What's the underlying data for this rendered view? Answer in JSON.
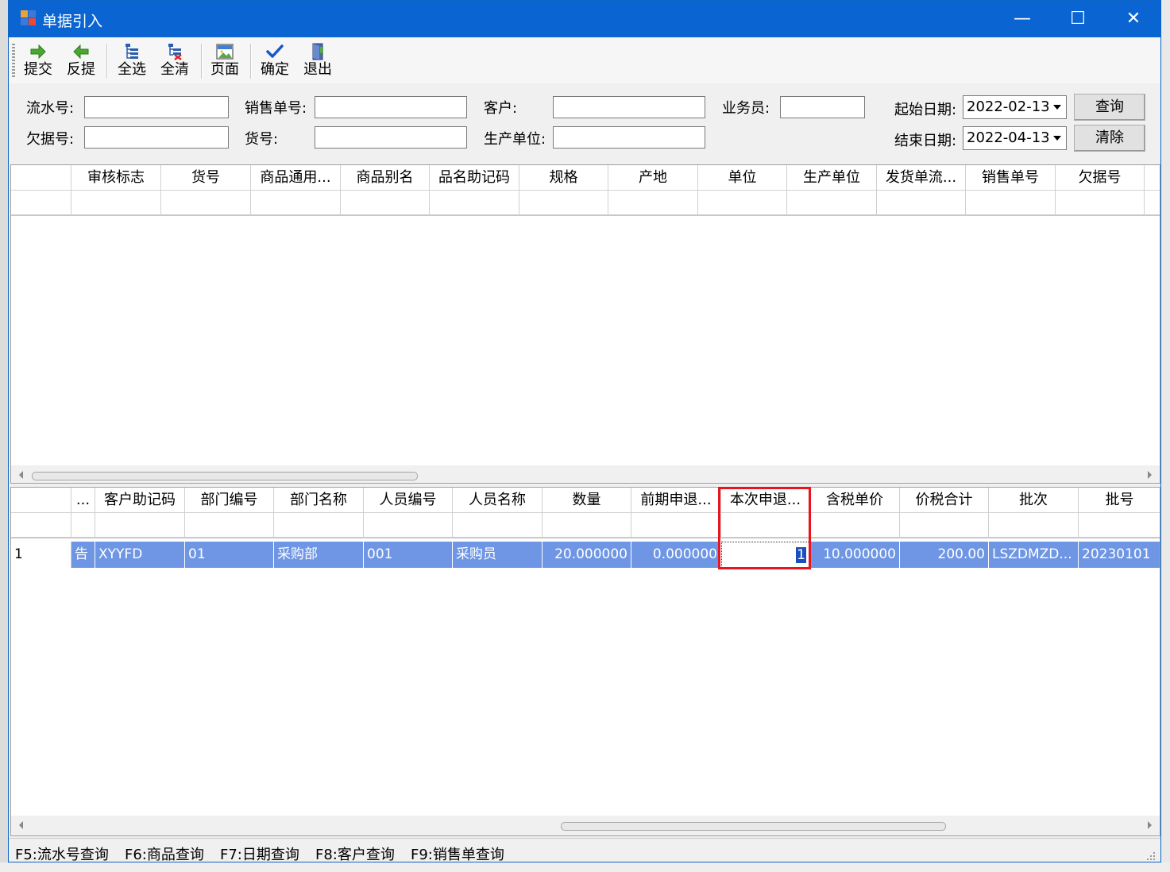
{
  "window": {
    "title": "单据引入",
    "minimize_glyph": "—",
    "maximize_glyph": "☐",
    "close_glyph": "✕"
  },
  "toolbar": {
    "submit": "提交",
    "unsubmit": "反提",
    "select_all": "全选",
    "clear_all": "全清",
    "page": "页面",
    "confirm": "确定",
    "exit": "退出"
  },
  "filters": {
    "serial_no_label": "流水号:",
    "serial_no_value": "",
    "sales_no_label": "销售单号:",
    "sales_no_value": "",
    "customer_label": "客户:",
    "customer_value": "",
    "salesman_label": "业务员:",
    "salesman_value": "",
    "debt_no_label": "欠据号:",
    "debt_no_value": "",
    "goods_no_label": "货号:",
    "goods_no_value": "",
    "manufacturer_label": "生产单位:",
    "manufacturer_value": "",
    "start_date_label": "起始日期:",
    "start_date_value": "2022-02-13",
    "end_date_label": "结束日期:",
    "end_date_value": "2022-04-13",
    "query_button": "查询",
    "clear_button": "清除"
  },
  "upper_grid": {
    "columns": [
      "审核标志",
      "货号",
      "商品通用...",
      "商品别名",
      "品名助记码",
      "规格",
      "产地",
      "单位",
      "生产单位",
      "发货单流...",
      "销售单号",
      "欠据号"
    ]
  },
  "lower_grid": {
    "columns": [
      "...",
      "客户助记码",
      "部门编号",
      "部门名称",
      "人员编号",
      "人员名称",
      "数量",
      "前期申退...",
      "本次申退...",
      "含税单价",
      "价税合计",
      "批次",
      "批号"
    ],
    "row": {
      "index": "1",
      "ellipsis_cell": "告",
      "customer_code": "XYYFD",
      "dept_no": "01",
      "dept_name": "采购部",
      "staff_no": "001",
      "staff_name": "采购员",
      "quantity": "20.000000",
      "prev_return": "0.000000",
      "this_return": "1",
      "unit_price": "10.000000",
      "total": "200.00",
      "batch": "LSZDMZD...",
      "lot_no": "20230101"
    }
  },
  "statusbar": {
    "f5": "F5:流水号查询",
    "f6": "F6:商品查询",
    "f7": "F7:日期查询",
    "f8": "F8:客户查询",
    "f9": "F9:销售单查询"
  },
  "colors": {
    "titlebar": "#0a64d2",
    "selected_row": "#6e96e4",
    "highlight_box": "#e8141e"
  },
  "icons": [
    "app-icon",
    "arrow-right-icon",
    "arrow-left-icon",
    "select-all-icon",
    "clear-all-icon",
    "page-icon",
    "checkmark-icon",
    "exit-door-icon"
  ]
}
